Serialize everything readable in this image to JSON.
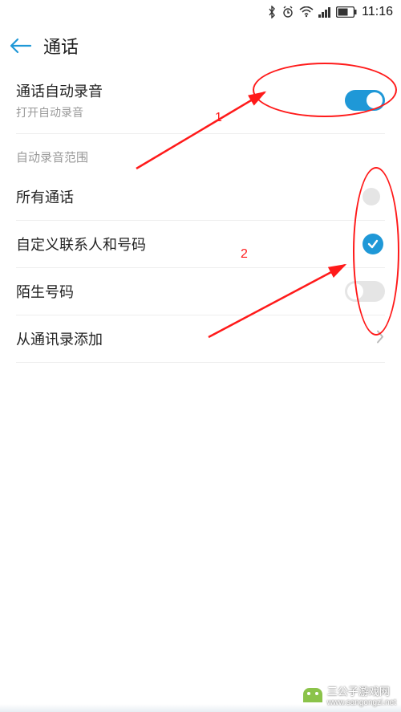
{
  "status_bar": {
    "time": "11:16"
  },
  "header": {
    "title": "通话"
  },
  "auto_record": {
    "title": "通话自动录音",
    "subtitle": "打开自动录音",
    "enabled": true
  },
  "scope_header": "自动录音范围",
  "options": {
    "all_calls": {
      "label": "所有通话",
      "selected": false
    },
    "custom_contacts": {
      "label": "自定义联系人和号码",
      "selected": true
    },
    "unknown_numbers": {
      "label": "陌生号码",
      "enabled": false
    }
  },
  "add_from_contacts": {
    "label": "从通讯录添加"
  },
  "annotations": {
    "label1": "1",
    "label2": "2"
  },
  "watermark": {
    "text": "三公子游戏网",
    "url": "www.sangongzi.net"
  }
}
